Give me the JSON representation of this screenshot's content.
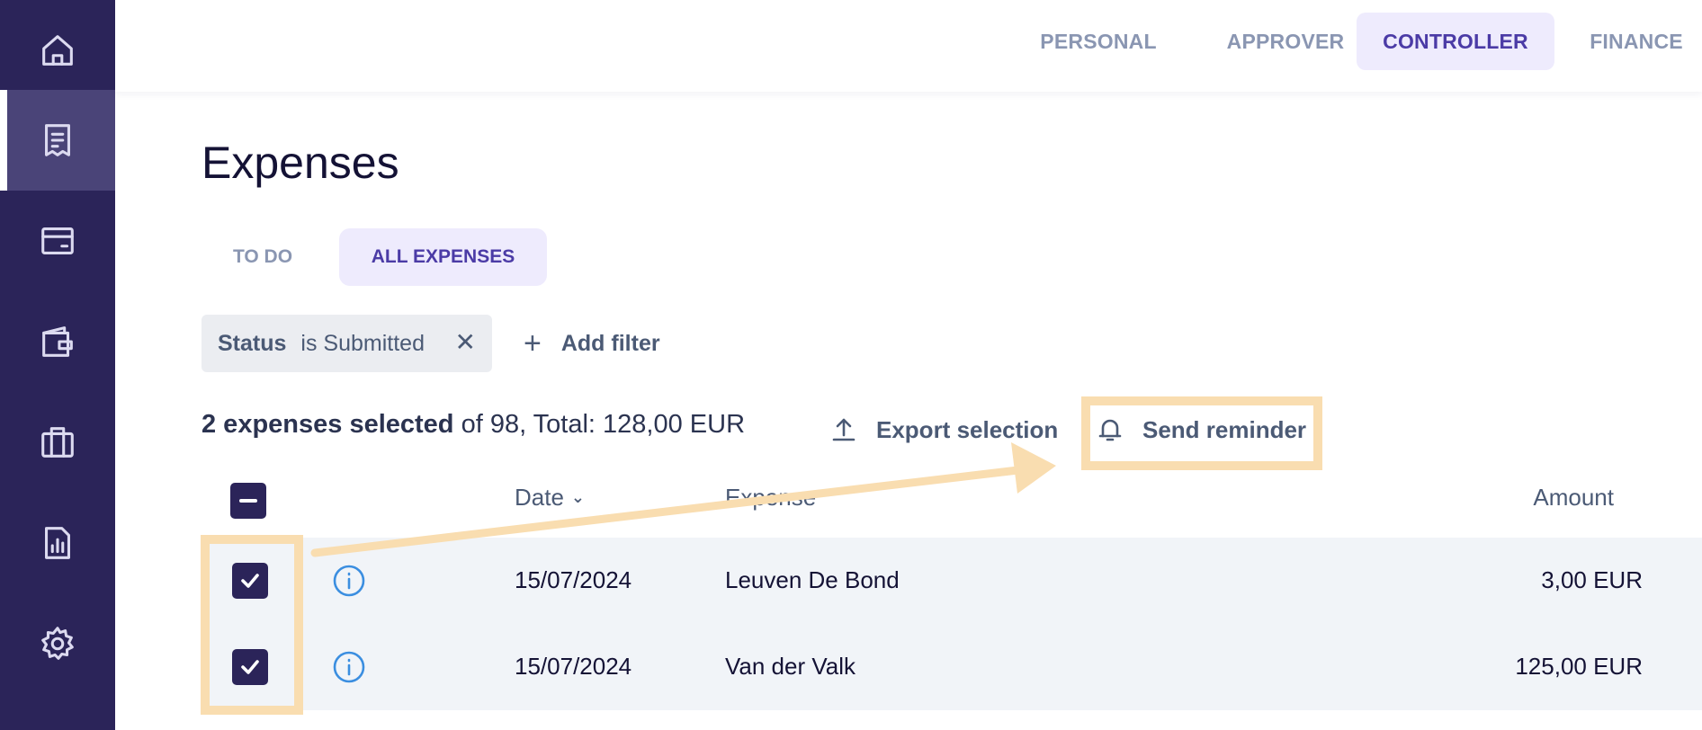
{
  "sidebar": {
    "items": [
      {
        "icon": "home-icon",
        "active": false
      },
      {
        "icon": "receipt-icon",
        "active": true
      },
      {
        "icon": "card-icon",
        "active": false
      },
      {
        "icon": "wallet-icon",
        "active": false
      },
      {
        "icon": "briefcase-icon",
        "active": false
      },
      {
        "icon": "report-icon",
        "active": false
      },
      {
        "icon": "gear-icon",
        "active": false
      }
    ]
  },
  "roles": {
    "tabs": [
      {
        "label": "PERSONAL",
        "active": false
      },
      {
        "label": "APPROVER",
        "active": false
      },
      {
        "label": "CONTROLLER",
        "active": true
      },
      {
        "label": "FINANCE",
        "active": false
      }
    ]
  },
  "page": {
    "title": "Expenses"
  },
  "views": {
    "tabs": [
      {
        "label": "TO DO",
        "active": false
      },
      {
        "label": "ALL EXPENSES",
        "active": true
      }
    ]
  },
  "filters": {
    "active": {
      "field": "Status",
      "condition": "is Submitted"
    },
    "remove_symbol": "✕",
    "add_label": "Add filter",
    "add_symbol": "+"
  },
  "selection": {
    "count_label": "2 expenses selected",
    "rest_label": " of 98, Total: 128,00 EUR",
    "export_label": "Export selection",
    "reminder_label": "Send reminder"
  },
  "table": {
    "columns": {
      "date": "Date",
      "expense": "Expense",
      "amount": "Amount"
    },
    "sort_symbol": "⌄",
    "rows": [
      {
        "date": "15/07/2024",
        "expense": "Leuven De Bond",
        "amount": "3,00 EUR",
        "checked": true
      },
      {
        "date": "15/07/2024",
        "expense": "Van der Valk",
        "amount": "125,00 EUR",
        "checked": true
      }
    ]
  },
  "colors": {
    "sidebar": "#2b2459",
    "accent": "#4b3ba6",
    "accent_bg": "#eeebfd",
    "annotation": "#f9ddb0",
    "info": "#3b8ee0"
  }
}
